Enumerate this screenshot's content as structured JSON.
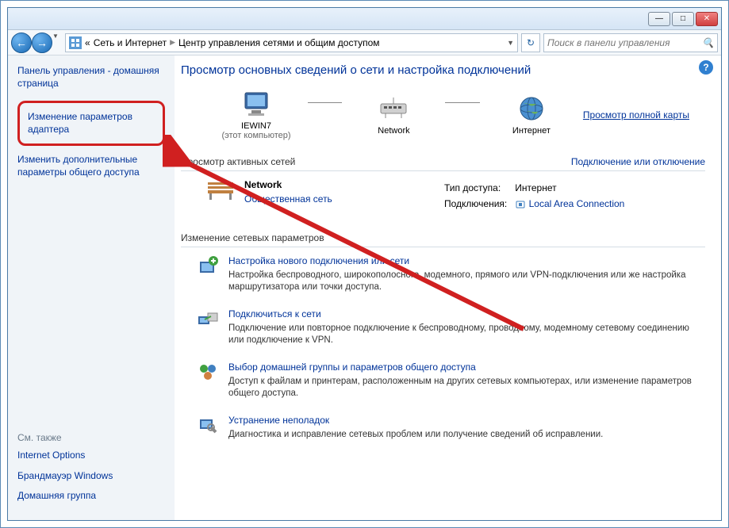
{
  "titlebar": {
    "minimize": "—",
    "maximize": "□",
    "close": "✕"
  },
  "navbar": {
    "back": "←",
    "forward": "→",
    "breadcrumb_prefix": "«",
    "breadcrumb_part1": "Сеть и Интернет",
    "breadcrumb_part2": "Центр управления сетями и общим доступом",
    "refresh": "↻",
    "search_placeholder": "Поиск в панели управления",
    "search_icon": "🔍"
  },
  "sidebar": {
    "home": "Панель управления - домашняя страница",
    "adapter_settings": "Изменение параметров адаптера",
    "advanced_sharing": "Изменить дополнительные параметры общего доступа",
    "see_also": "См. также",
    "links": {
      "internet_options": "Internet Options",
      "firewall": "Брандмауэр Windows",
      "homegroup": "Домашняя группа"
    }
  },
  "content": {
    "help": "?",
    "title": "Просмотр основных сведений о сети и настройка подключений",
    "map": {
      "node1_name": "IEWIN7",
      "node1_sub": "(этот компьютер)",
      "node2_name": "Network",
      "node3_name": "Интернет",
      "full_map_link": "Просмотр полной карты"
    },
    "active_section": {
      "header": "Просмотр активных сетей",
      "right_link": "Подключение или отключение",
      "net_name": "Network",
      "net_type": "Общественная сеть",
      "access_label": "Тип доступа:",
      "access_value": "Интернет",
      "conn_label": "Подключения:",
      "conn_value": "Local Area Connection"
    },
    "change_section": {
      "header": "Изменение сетевых параметров",
      "tasks": [
        {
          "title": "Настройка нового подключения или сети",
          "desc": "Настройка беспроводного, широкополосного, модемного, прямого или VPN-подключения или же настройка маршрутизатора или точки доступа."
        },
        {
          "title": "Подключиться к сети",
          "desc": "Подключение или повторное подключение к беспроводному, проводному, модемному сетевому соединению или подключение к VPN."
        },
        {
          "title": "Выбор домашней группы и параметров общего доступа",
          "desc": "Доступ к файлам и принтерам, расположенным на других сетевых компьютерах, или изменение параметров общего доступа."
        },
        {
          "title": "Устранение неполадок",
          "desc": "Диагностика и исправление сетевых проблем или получение сведений об исправлении."
        }
      ]
    }
  }
}
